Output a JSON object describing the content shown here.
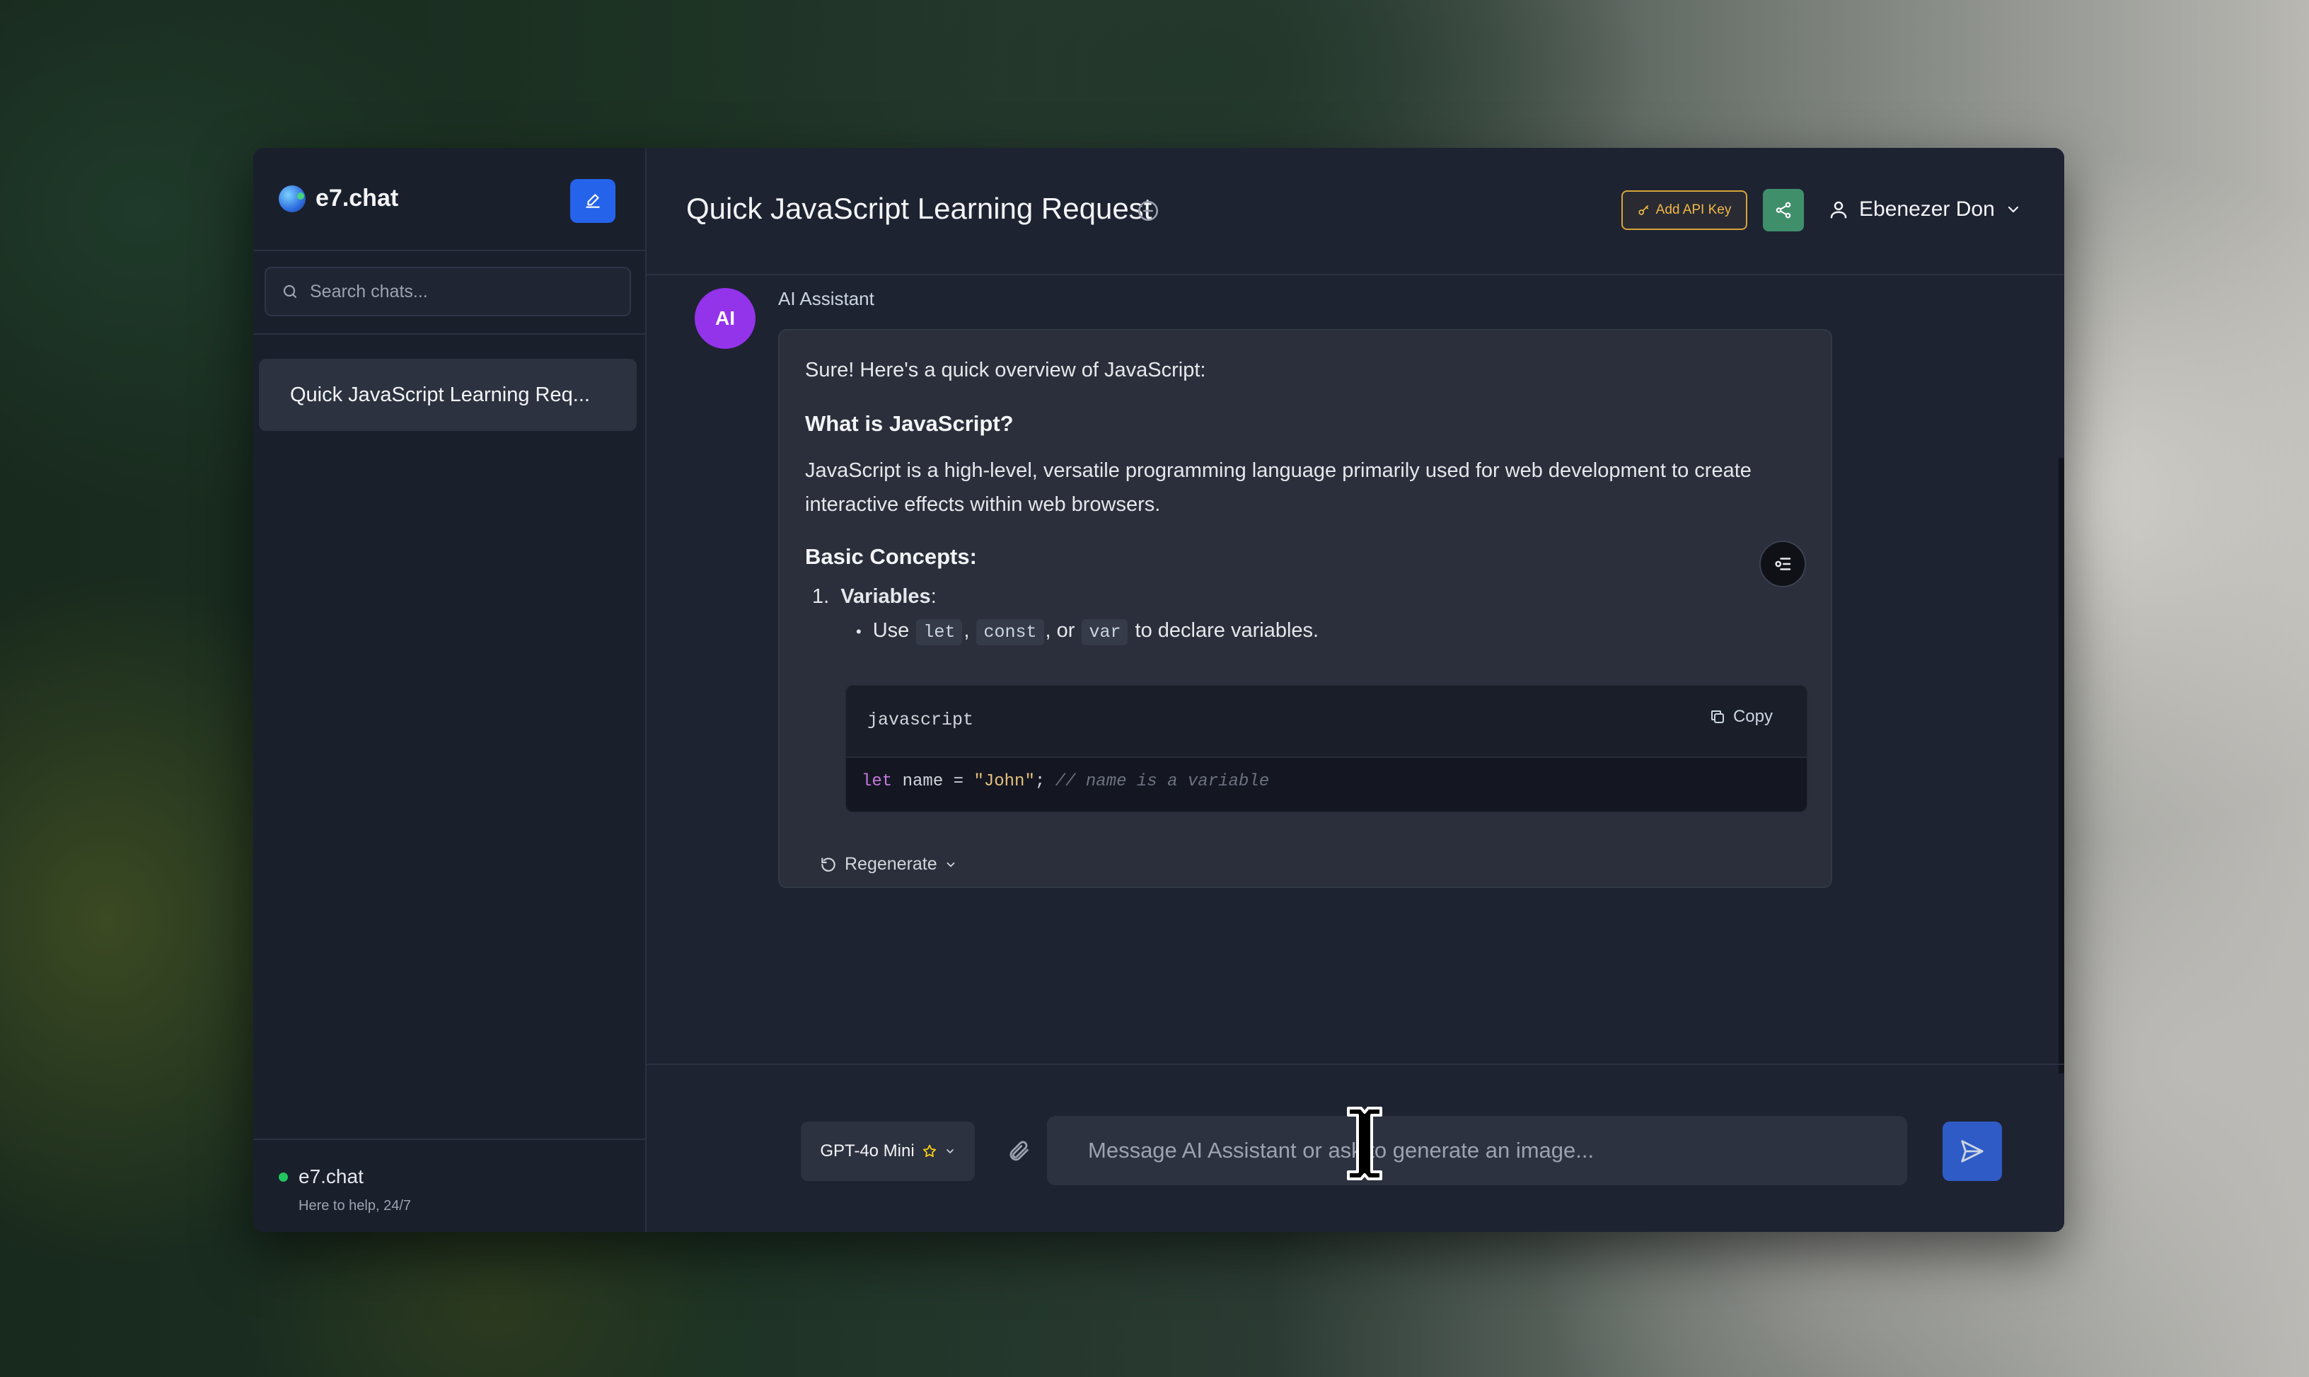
{
  "sidebar": {
    "brand": "e7.chat",
    "search_placeholder": "Search chats...",
    "chats": [
      {
        "label": "Quick JavaScript Learning Req..."
      }
    ],
    "footer": {
      "name": "e7.chat",
      "subtitle": "Here to help, 24/7"
    }
  },
  "header": {
    "title": "Quick JavaScript Learning Request",
    "api_key_label": "Add API Key",
    "user_name": "Ebenezer Don"
  },
  "message": {
    "avatar": "AI",
    "sender": "AI Assistant",
    "intro": "Sure! Here's a quick overview of JavaScript:",
    "heading1": "What is JavaScript?",
    "para1": "JavaScript is a high-level, versatile programming language primarily used for web development to create interactive effects within web browsers.",
    "heading2": "Basic Concepts:",
    "list_number": "1.",
    "list_title": "Variables",
    "list_colon": ":",
    "bullet_prefix": "Use",
    "kw_let": "let",
    "kw_const": "const",
    "kw_var": "var",
    "sep1": ",",
    "sep2": ", or",
    "bullet_suffix": "to declare variables.",
    "code": {
      "language": "javascript",
      "copy_label": "Copy",
      "kw": "let",
      "ident": " name = ",
      "string": "\"John\"",
      "semi": "; ",
      "comment": "// name is a variable"
    },
    "regenerate_label": "Regenerate"
  },
  "composer": {
    "model": "GPT-4o Mini",
    "placeholder": "Message AI Assistant or ask to generate an image..."
  },
  "colors": {
    "accent": "#2563eb",
    "avatar": "#9333ea",
    "api_key": "#d6a53a",
    "share": "#3f8f6b",
    "online": "#22c55e"
  }
}
